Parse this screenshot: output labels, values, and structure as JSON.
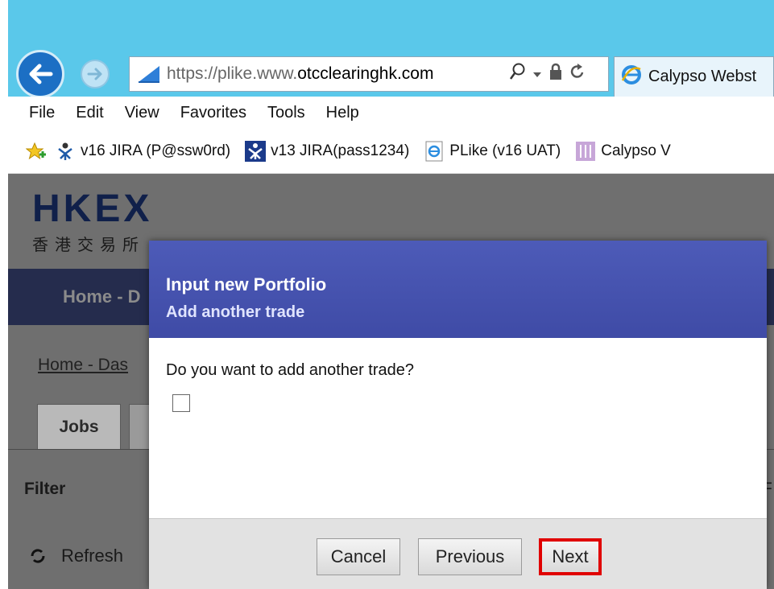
{
  "browser": {
    "address": {
      "scheme": "https://",
      "pre": "plike.www.",
      "domain": "otcclearinghk.com",
      "search_icon": "search-icon",
      "dropdown_icon": "chevron-down-icon",
      "lock_icon": "lock-icon",
      "refresh_icon": "refresh-icon"
    },
    "tab": {
      "label": "Calypso Webst"
    },
    "menu": [
      "File",
      "Edit",
      "View",
      "Favorites",
      "Tools",
      "Help"
    ],
    "favorites": [
      {
        "label": "v16 JIRA (P@ssw0rd)",
        "icon": "jira-icon"
      },
      {
        "label": "v13 JIRA(pass1234)",
        "icon": "jira-icon"
      },
      {
        "label": "PLike (v16 UAT)",
        "icon": "ie-page-icon"
      },
      {
        "label": "Calypso V",
        "icon": "calypso-icon"
      }
    ]
  },
  "page": {
    "logo_main": "HKEX",
    "logo_sub": "香港交易所",
    "nav_home": "Home - D",
    "breadcrumb": "Home - Das",
    "tabs": {
      "jobs": "Jobs"
    },
    "filter": "Filter",
    "refresh": "Refresh",
    "right_letter": "F"
  },
  "dialog": {
    "title": "Input new Portfolio",
    "subtitle": "Add another trade",
    "question": "Do you want to add another trade?",
    "checkbox_checked": false,
    "buttons": {
      "cancel": "Cancel",
      "previous": "Previous",
      "next": "Next"
    }
  },
  "colors": {
    "titlebar": "#5ac8ea",
    "dialog_header": "#4d5bb8",
    "highlight": "#e00000",
    "nav_band": "#252c4d"
  }
}
